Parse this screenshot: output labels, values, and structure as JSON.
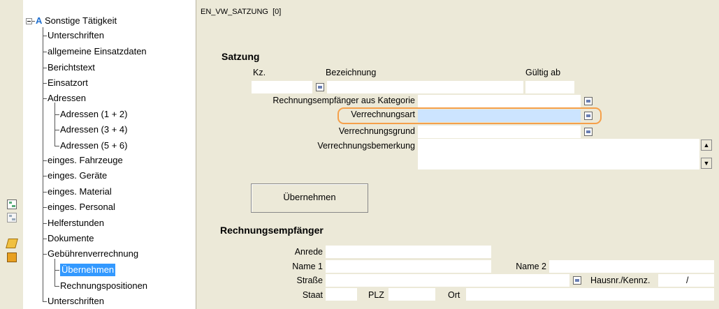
{
  "tree": {
    "root_letter": "A",
    "root_label": "Sonstige Tätigkeit",
    "items": [
      "Unterschriften",
      "allgemeine Einsatzdaten",
      "Berichtstext",
      "Einsatzort",
      "Adressen",
      "Adressen (1 + 2)",
      "Adressen (3 + 4)",
      "Adressen (5 + 6)",
      "einges. Fahrzeuge",
      "einges. Geräte",
      "einges. Material",
      "einges. Personal",
      "Helferstunden",
      "Dokumente",
      "Gebührenverrechnung",
      "Übernehmen",
      "Rechnungspositionen",
      "Unterschriften"
    ],
    "selected": "Übernehmen"
  },
  "panel": {
    "title": "EN_VW_SATZUNG  [0]",
    "satzung": {
      "heading": "Satzung",
      "col_kz": "Kz.",
      "col_bezeichnung": "Bezeichnung",
      "col_gueltig": "Gültig ab",
      "lbl_empfaenger_kategorie": "Rechnungsempfänger aus Kategorie",
      "lbl_verrechnungsart": "Verrechnungsart",
      "lbl_verrechnungsgrund": "Verrechnungsgrund",
      "lbl_verrechnungsbemerkung": "Verrechnungsbemerkung",
      "button_uebernehmen": "Übernehmen"
    },
    "empfaenger": {
      "heading": "Rechnungsempfänger",
      "lbl_anrede": "Anrede",
      "lbl_name1": "Name 1",
      "lbl_name2": "Name 2",
      "lbl_strasse": "Straße",
      "lbl_hausnr": "Hausnr./Kennz.",
      "hausnr_sep": "/",
      "lbl_staat": "Staat",
      "lbl_plz": "PLZ",
      "lbl_ort": "Ort"
    }
  },
  "colors": {
    "highlight_field": "#cce4ff",
    "highlight_border": "#f5a04a",
    "selection": "#3399ff"
  }
}
